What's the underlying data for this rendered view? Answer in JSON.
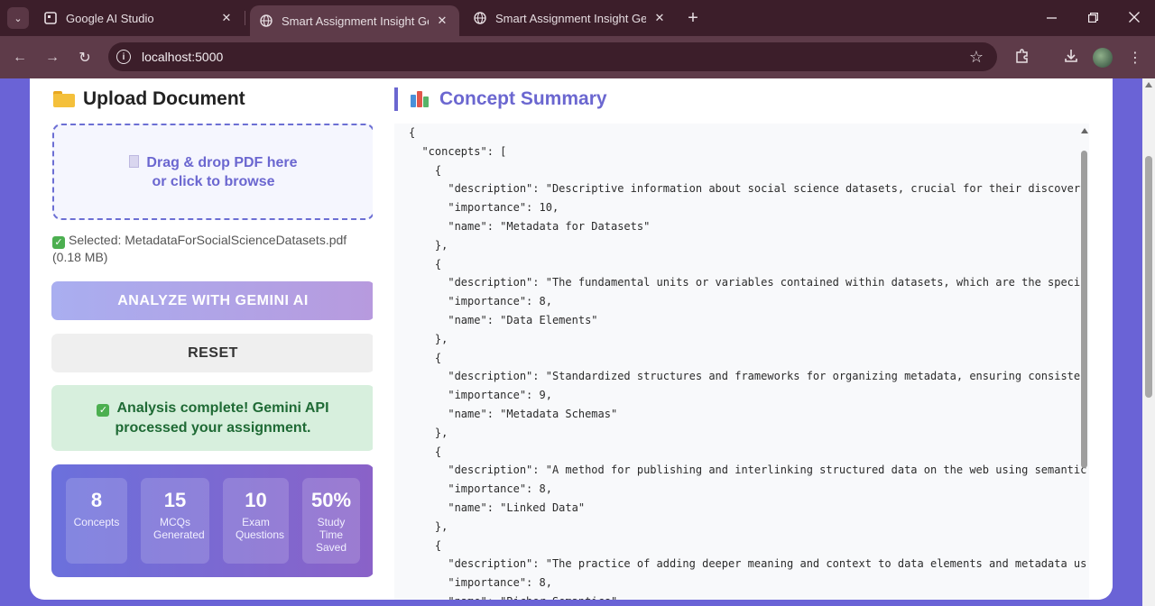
{
  "browser": {
    "tabs": [
      {
        "title": "Google AI Studio",
        "icon": "ai-studio-icon",
        "close": "✕"
      },
      {
        "title": "Smart Assignment Insight Gene",
        "icon": "globe-icon",
        "close": "✕"
      },
      {
        "title": "Smart Assignment Insight Gene",
        "icon": "globe-icon",
        "close": "✕"
      }
    ],
    "new_tab": "+",
    "url": "localhost:5000"
  },
  "upload": {
    "heading": "Upload Document",
    "dropzone_line1": "Drag & drop PDF here",
    "dropzone_line2": "or click to browse",
    "selected_text": "Selected: MetadataForSocialScienceDatasets.pdf (0.18 MB)",
    "analyze_label": "ANALYZE WITH GEMINI AI",
    "reset_label": "RESET",
    "success_text": "Analysis complete! Gemini API processed your assignment."
  },
  "stats": [
    {
      "value": "8",
      "label": "Concepts"
    },
    {
      "value": "15",
      "label": "MCQs Generated"
    },
    {
      "value": "10",
      "label": "Exam Questions"
    },
    {
      "value": "50%",
      "label": "Study Time Saved"
    }
  ],
  "concept_summary": {
    "heading": "Concept Summary",
    "json_lines": [
      "{",
      "  \"concepts\": [",
      "    {",
      "      \"description\": \"Descriptive information about social science datasets, crucial for their discovery",
      "      \"importance\": 10,",
      "      \"name\": \"Metadata for Datasets\"",
      "    },",
      "    {",
      "      \"description\": \"The fundamental units or variables contained within datasets, which are the specif",
      "      \"importance\": 8,",
      "      \"name\": \"Data Elements\"",
      "    },",
      "    {",
      "      \"description\": \"Standardized structures and frameworks for organizing metadata, ensuring consister",
      "      \"importance\": 9,",
      "      \"name\": \"Metadata Schemas\"",
      "    },",
      "    {",
      "      \"description\": \"A method for publishing and interlinking structured data on the web using semantic",
      "      \"importance\": 8,",
      "      \"name\": \"Linked Data\"",
      "    },",
      "    {",
      "      \"description\": \"The practice of adding deeper meaning and context to data elements and metadata us",
      "      \"importance\": 8,",
      "      \"name\": \"Richer Semantics\""
    ]
  }
}
